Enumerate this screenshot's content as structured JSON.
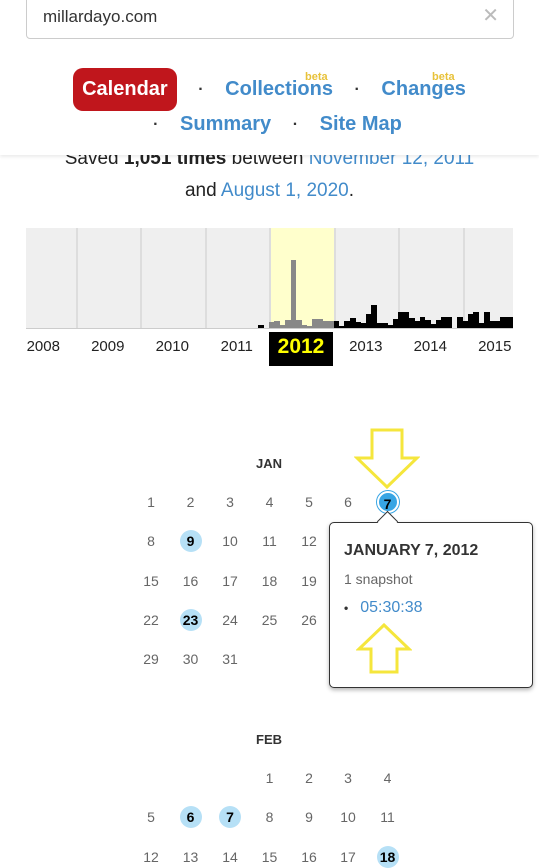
{
  "search": {
    "value": "millardayo.com",
    "clear_icon": "close-icon"
  },
  "nav": {
    "calendar": "Calendar",
    "collections": "Collections",
    "changes": "Changes",
    "summary": "Summary",
    "sitemap": "Site Map",
    "beta": "beta",
    "separator": "·",
    "active_color": "#c0161c",
    "link_color": "#428bca"
  },
  "summary": {
    "prefix": "Saved ",
    "count": "1,051 times",
    "between": " between ",
    "start": "November 12, 2011",
    "and": "and ",
    "end": "August 1, 2020",
    "period": "."
  },
  "chart_data": {
    "type": "bar",
    "title": "",
    "categories": [
      "2008",
      "2009",
      "2010",
      "2011",
      "2012",
      "2013",
      "2014",
      "2015"
    ],
    "selected": "2012",
    "series": [
      {
        "values_by_year": {
          "2008": [
            0,
            0,
            0,
            0,
            0,
            0,
            0,
            0,
            0,
            0,
            0,
            0
          ],
          "2009": [
            0,
            0,
            0,
            0,
            0,
            0,
            0,
            0,
            0,
            0,
            0,
            0
          ],
          "2010": [
            0,
            0,
            0,
            0,
            0,
            0,
            0,
            0,
            0,
            0,
            0,
            0
          ],
          "2011": [
            0,
            0,
            0,
            0,
            0,
            0,
            0,
            0,
            0,
            0,
            3,
            0
          ],
          "2012": [
            6,
            7,
            3,
            8,
            65,
            8,
            3,
            2,
            9,
            9,
            7,
            7
          ],
          "2013": [
            7,
            2,
            7,
            10,
            6,
            5,
            13,
            22,
            5,
            5,
            3,
            9
          ],
          "2014": [
            15,
            15,
            10,
            7,
            11,
            8,
            4,
            8,
            11,
            11,
            0,
            11
          ],
          "2015": [
            7,
            13,
            15,
            5,
            15,
            7,
            7,
            11,
            11,
            11
          ]
        }
      }
    ]
  },
  "calendar": {
    "months": [
      {
        "name": "JAN",
        "start_weekday": 0,
        "days": 31,
        "highlighted": [
          9,
          23
        ],
        "selected": 7
      },
      {
        "name": "FEB",
        "start_weekday": 3,
        "days": 29,
        "highlighted": [
          6,
          7,
          18
        ],
        "selected": null
      }
    ]
  },
  "tooltip": {
    "date": "JANUARY 7, 2012",
    "count": "1 snapshot",
    "bullet": "•",
    "time": "05:30:38"
  },
  "annotations": {
    "color": "#f5e63c",
    "icons": [
      "arrow-down-icon",
      "arrow-up-icon"
    ]
  }
}
